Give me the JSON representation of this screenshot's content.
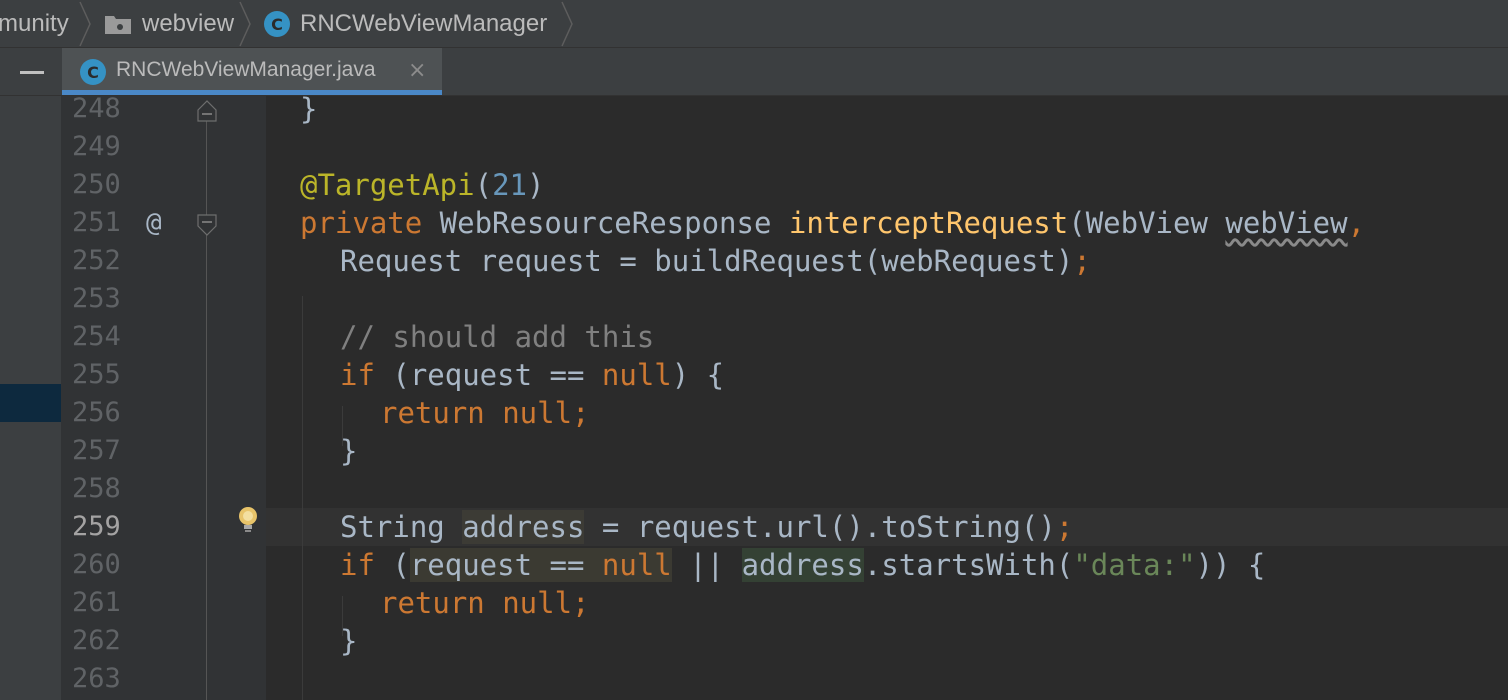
{
  "breadcrumb": {
    "items": [
      {
        "label": "munity"
      },
      {
        "label": "webview",
        "icon": "folder-icon"
      },
      {
        "label": "RNCWebViewManager",
        "icon": "class-c-icon"
      }
    ]
  },
  "tabs": [
    {
      "label": "RNCWebViewManager.java",
      "icon": "class-c-icon",
      "close": "×"
    }
  ],
  "icons": {
    "class_letter": "C"
  },
  "gutter": {
    "line_numbers": [
      "248",
      "249",
      "250",
      "251",
      "252",
      "253",
      "254",
      "255",
      "256",
      "257",
      "258",
      "259",
      "260",
      "261",
      "262",
      "263"
    ],
    "override_marker": "@",
    "active_line": "259"
  },
  "code": {
    "l248": "}",
    "l250_ann": "@TargetApi",
    "l250_p1": "(",
    "l250_num": "21",
    "l250_p2": ")",
    "l251_kw": "private",
    "l251_type": " WebResourceResponse ",
    "l251_fn": "interceptRequest",
    "l251_rest": "(WebView ",
    "l251_param": "webView",
    "l251_comma": ",",
    "l252_text": "Request request = buildRequest(webRequest)",
    "l252_semi": ";",
    "l254_comment": "// should add this",
    "l255_kw": "if",
    "l255_a": " (request == ",
    "l255_null": "null",
    "l255_b": ") {",
    "l256_ret": "return null;",
    "l257": "}",
    "l259_a": "String ",
    "l259_var": "address",
    "l259_b": " = request.url().toString()",
    "l259_semi": ";",
    "l260_kw": "if",
    "l260_a": " (",
    "l260_warn": "request == null",
    "l260_b": " || ",
    "l260_var": "address",
    "l260_c": ".startsWith(",
    "l260_str": "\"data:\"",
    "l260_d": ")) {",
    "l261_ret": "return null;",
    "l262": "}"
  },
  "colors": {
    "background": "#2b2b2b",
    "keyword": "#cc7832",
    "annotation": "#bbb529",
    "number": "#6897bb",
    "method": "#ffc66d",
    "comment": "#808080",
    "string": "#6a8759",
    "tab_accent": "#4a88c7"
  }
}
